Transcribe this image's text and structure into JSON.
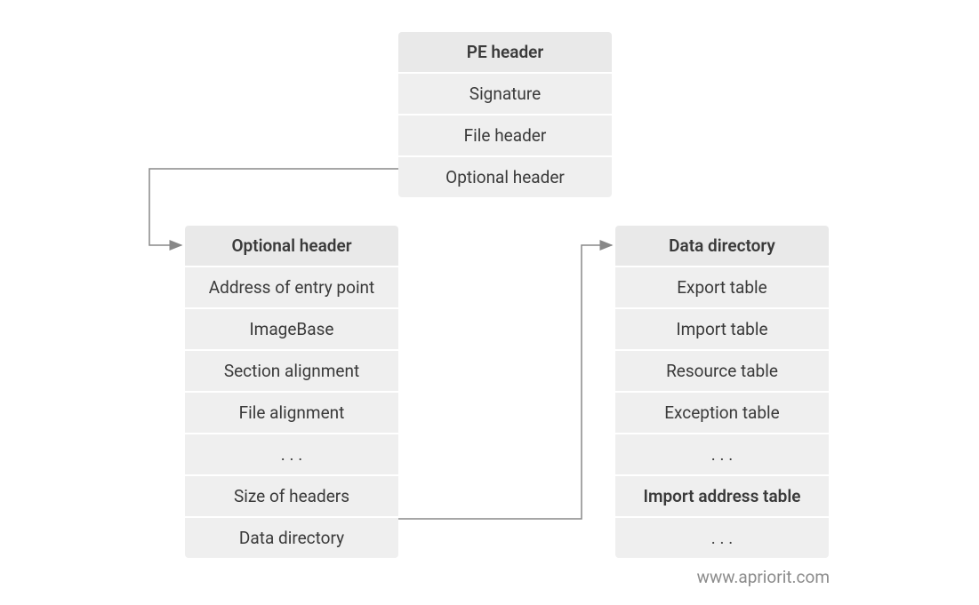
{
  "pe_header": {
    "title": "PE header",
    "rows": [
      "Signature",
      "File header",
      "Optional header"
    ]
  },
  "optional_header": {
    "title": "Optional header",
    "rows": [
      "Address of entry point",
      "ImageBase",
      "Section alignment",
      "File alignment",
      ". . .",
      "Size of headers",
      "Data directory"
    ]
  },
  "data_directory": {
    "title": "Data directory",
    "rows": [
      {
        "label": "Export table",
        "bold": false
      },
      {
        "label": "Import table",
        "bold": false
      },
      {
        "label": "Resource table",
        "bold": false
      },
      {
        "label": "Exception table",
        "bold": false
      },
      {
        "label": ". . .",
        "bold": false
      },
      {
        "label": "Import address table",
        "bold": true
      },
      {
        "label": ". . .",
        "bold": false
      }
    ]
  },
  "watermark": "www.apriorit.com"
}
